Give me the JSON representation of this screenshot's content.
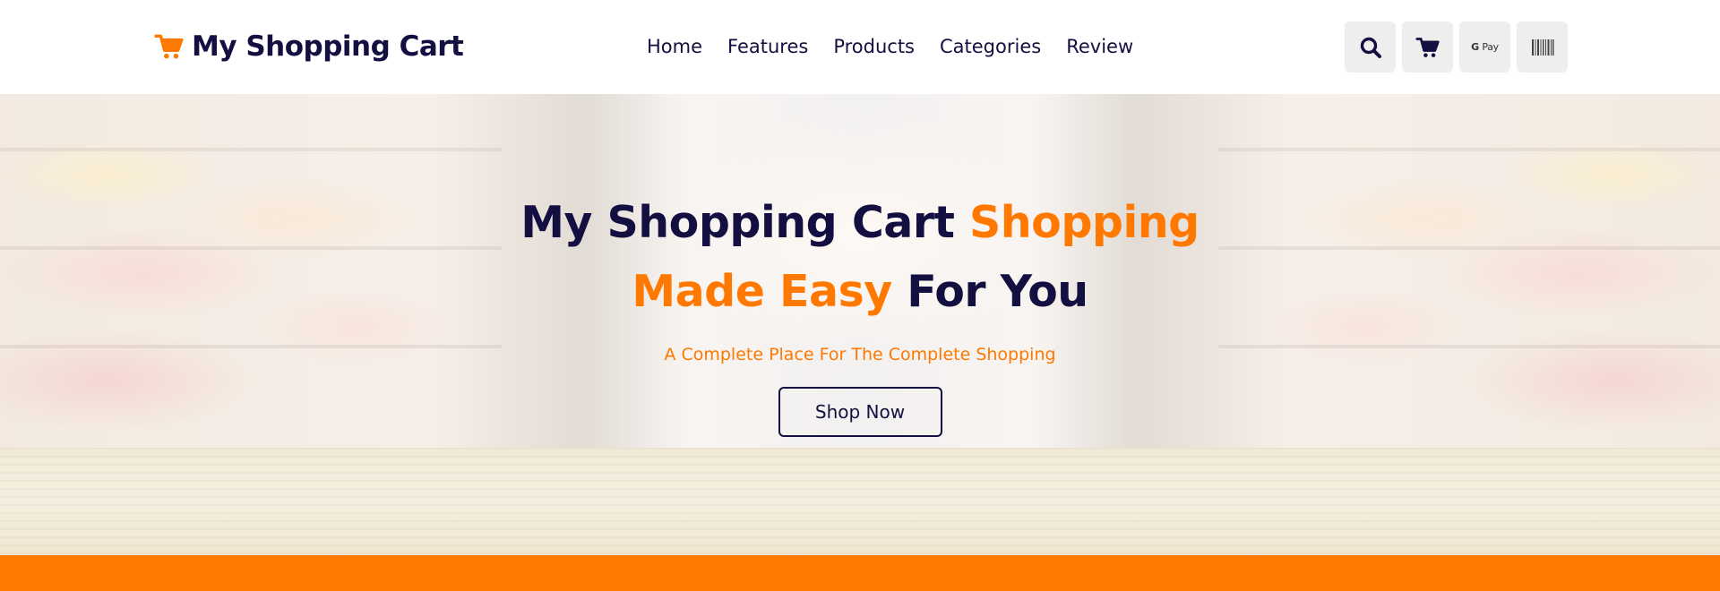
{
  "header": {
    "logo_text": "My Shopping Cart",
    "logo_icon": "shopping-cart-icon",
    "nav": [
      {
        "label": "Home"
      },
      {
        "label": "Features"
      },
      {
        "label": "Products"
      },
      {
        "label": "Categories"
      },
      {
        "label": "Review"
      }
    ],
    "icons": [
      {
        "name": "search-icon"
      },
      {
        "name": "cart-icon"
      },
      {
        "name": "gpay-icon",
        "label_g": "G",
        "label_pay": "Pay"
      },
      {
        "name": "barcode-icon"
      }
    ]
  },
  "hero": {
    "title_part1": "My Shopping Cart ",
    "title_accent": "Shopping Made Easy",
    "title_part2": " For You",
    "subtitle": "A Complete Place For The Complete Shopping",
    "button_label": "Shop Now"
  },
  "colors": {
    "primary": "#130f40",
    "accent": "#ff7800",
    "icon_bg": "#eeeeee"
  }
}
